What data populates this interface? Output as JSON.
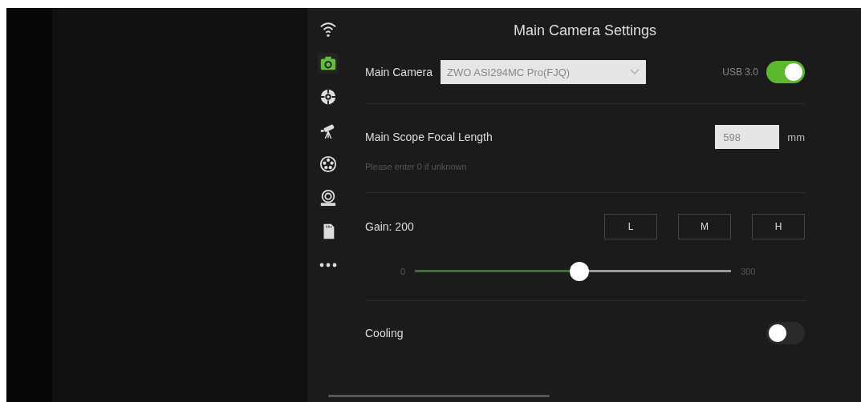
{
  "sidebar": {
    "items": [
      {
        "kind": "wifi",
        "selected": false
      },
      {
        "kind": "camera",
        "selected": true
      },
      {
        "kind": "guide",
        "selected": false
      },
      {
        "kind": "telescope",
        "selected": false
      },
      {
        "kind": "wheel",
        "selected": false
      },
      {
        "kind": "focuser",
        "selected": false
      },
      {
        "kind": "storage",
        "selected": false
      },
      {
        "kind": "more",
        "selected": false
      }
    ]
  },
  "title": "Main Camera Settings",
  "main_camera": {
    "label": "Main Camera",
    "value": "ZWO ASI294MC Pro(FJQ)",
    "usb_label": "USB 3.0",
    "usb_on": true
  },
  "focal_length": {
    "label": "Main Scope Focal Length",
    "hint": "Please enter 0 if unknown",
    "value": "598",
    "unit": "mm"
  },
  "gain": {
    "label": "Gain: 200",
    "presets": [
      "L",
      "M",
      "H"
    ],
    "min": "0",
    "max": "300",
    "level": 0.52
  },
  "cooling": {
    "label": "Cooling",
    "on": false
  }
}
